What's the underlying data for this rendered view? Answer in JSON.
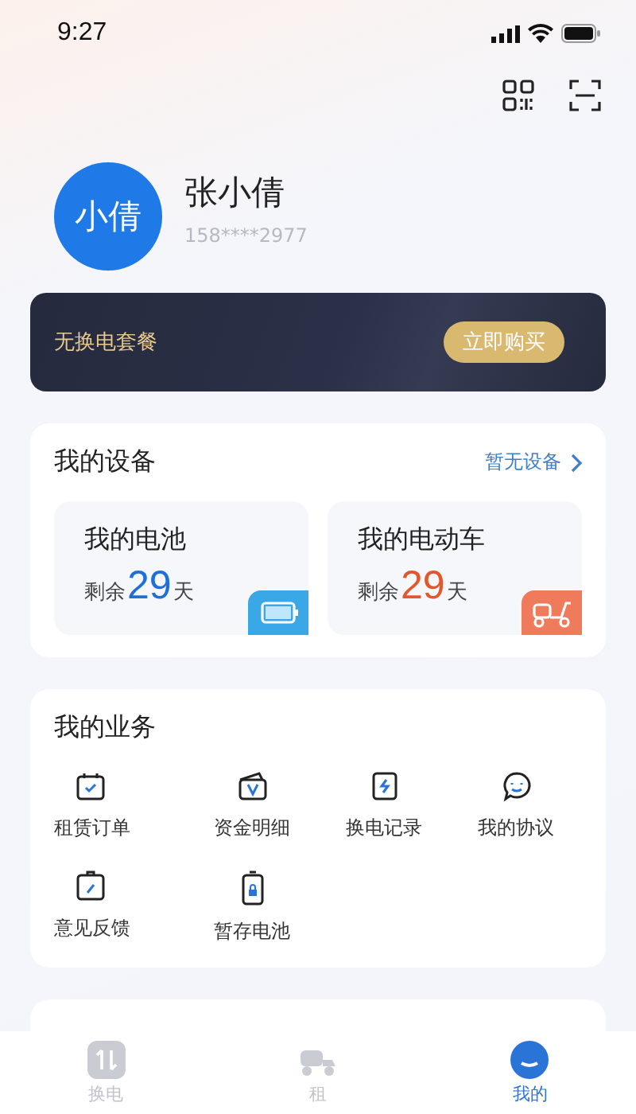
{
  "status_bar": {
    "time": "9:27"
  },
  "profile": {
    "avatar_text": "小倩",
    "name": "张小倩",
    "phone": "158****2977"
  },
  "banner": {
    "text": "无换电套餐",
    "button": "立即购买"
  },
  "devices": {
    "title": "我的设备",
    "link": "暂无设备",
    "cards": [
      {
        "kind": "battery",
        "title": "我的电池",
        "prefix": "剩余",
        "days": "29",
        "suffix": "天",
        "color": "#1f6fd8"
      },
      {
        "kind": "scooter",
        "title": "我的电动车",
        "prefix": "剩余",
        "days": "29",
        "suffix": "天",
        "color": "#e0582e"
      }
    ]
  },
  "business": {
    "title": "我的业务",
    "items": [
      {
        "kind": "order",
        "label": "租赁订单"
      },
      {
        "kind": "wallet",
        "label": "资金明细"
      },
      {
        "kind": "swap",
        "label": "换电记录"
      },
      {
        "kind": "chat",
        "label": "我的协议"
      },
      {
        "kind": "feedback",
        "label": "意见反馈"
      },
      {
        "kind": "storage",
        "label": "暂存电池"
      }
    ]
  },
  "tab_bar": [
    {
      "kind": "swap",
      "label": "换电",
      "selected": false
    },
    {
      "kind": "rent",
      "label": "租",
      "selected": false
    },
    {
      "kind": "me",
      "label": "我的",
      "selected": true
    }
  ]
}
